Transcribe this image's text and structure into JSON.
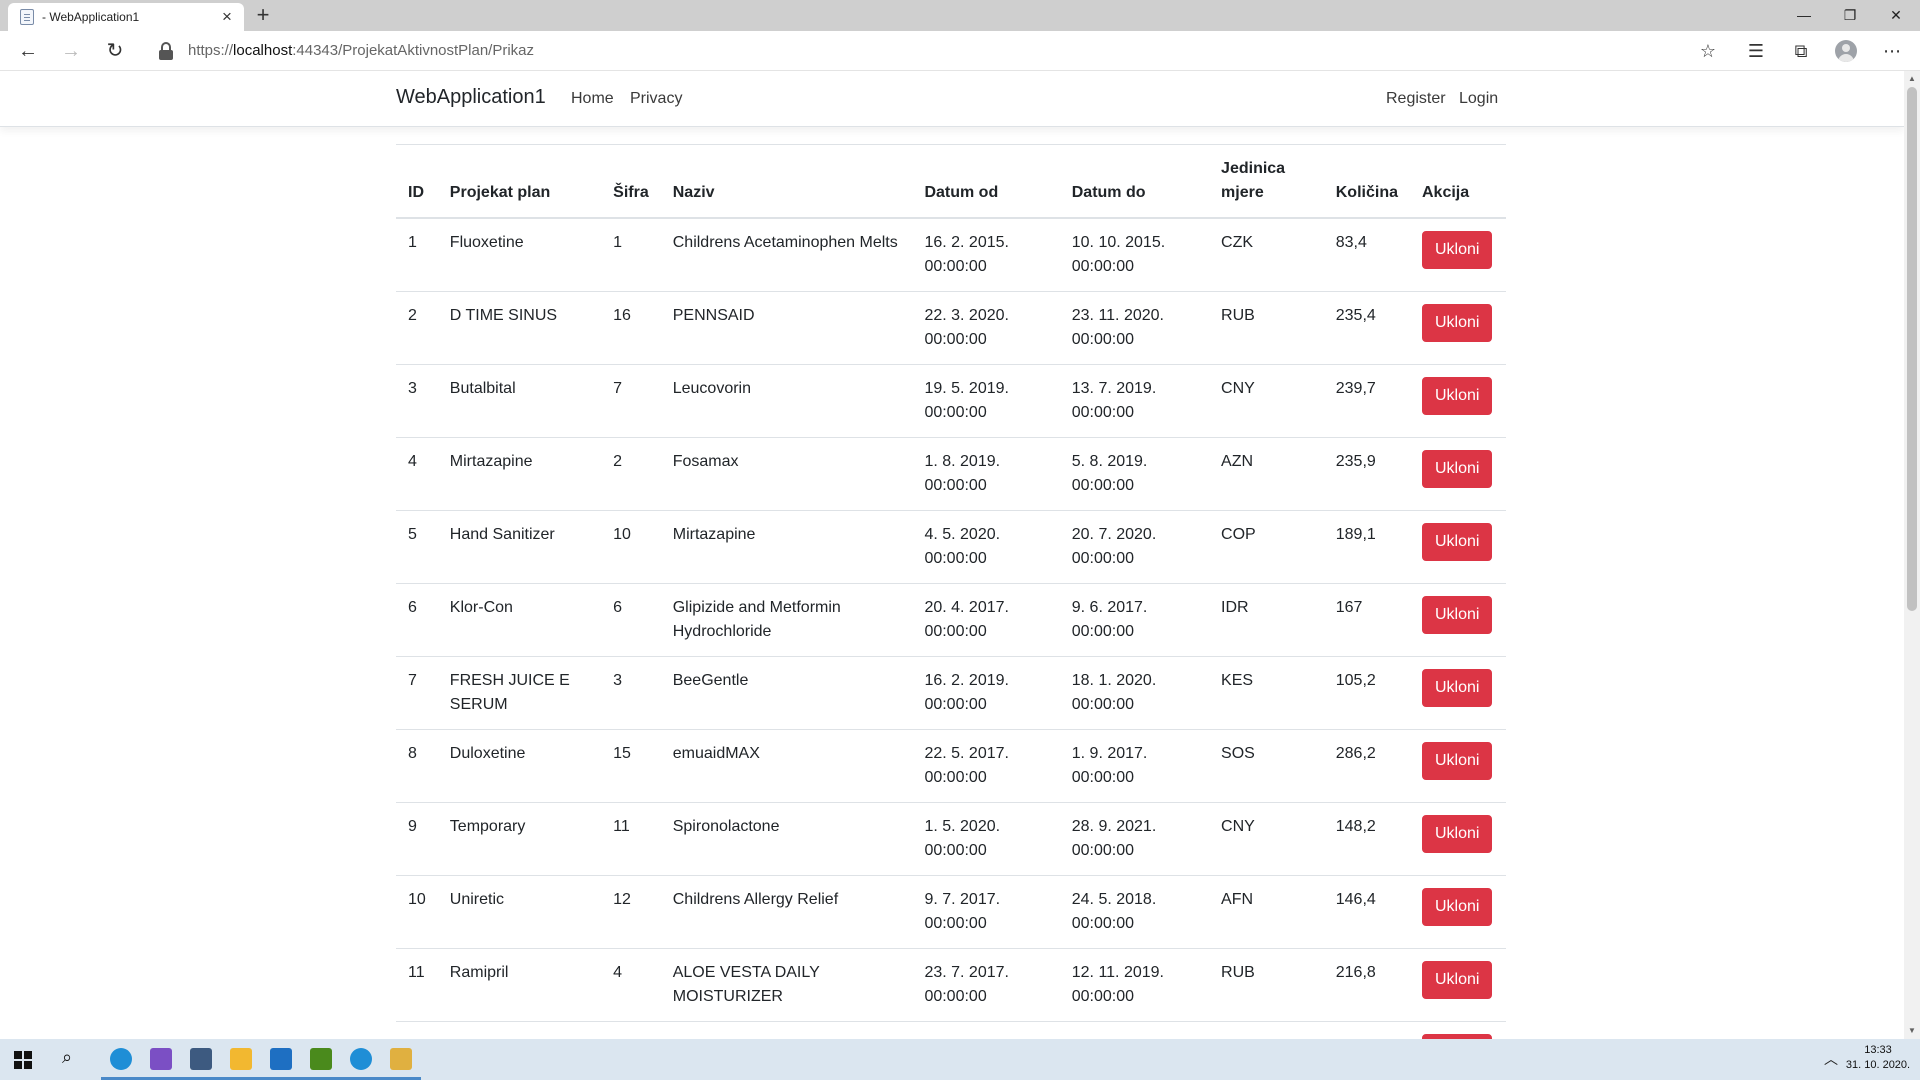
{
  "browser": {
    "tab_title": " - WebApplication1",
    "url_scheme": "https://",
    "url_host": "localhost",
    "url_path": ":44343/ProjekatAktivnostPlan/Prikaz"
  },
  "site": {
    "brand": "WebApplication1",
    "nav": {
      "home": "Home",
      "privacy": "Privacy",
      "register": "Register",
      "login": "Login"
    }
  },
  "table": {
    "headers": {
      "id": "ID",
      "plan": "Projekat plan",
      "sifra": "Šifra",
      "naziv": "Naziv",
      "datum_od": "Datum od",
      "datum_do": "Datum do",
      "jedinica": "Jedinica mjere",
      "kolicina": "Količina",
      "akcija": "Akcija"
    },
    "action_label": "Ukloni",
    "rows": [
      {
        "id": "1",
        "plan": "Fluoxetine",
        "sifra": "1",
        "naziv": "Childrens Acetaminophen Melts",
        "od": "16. 2. 2015. 00:00:00",
        "do": "10. 10. 2015. 00:00:00",
        "jm": "CZK",
        "kol": "83,4"
      },
      {
        "id": "2",
        "plan": "D TIME SINUS",
        "sifra": "16",
        "naziv": "PENNSAID",
        "od": "22. 3. 2020. 00:00:00",
        "do": "23. 11. 2020. 00:00:00",
        "jm": "RUB",
        "kol": "235,4"
      },
      {
        "id": "3",
        "plan": "Butalbital",
        "sifra": "7",
        "naziv": "Leucovorin",
        "od": "19. 5. 2019. 00:00:00",
        "do": "13. 7. 2019. 00:00:00",
        "jm": "CNY",
        "kol": "239,7"
      },
      {
        "id": "4",
        "plan": "Mirtazapine",
        "sifra": "2",
        "naziv": "Fosamax",
        "od": "1. 8. 2019. 00:00:00",
        "do": "5. 8. 2019. 00:00:00",
        "jm": "AZN",
        "kol": "235,9"
      },
      {
        "id": "5",
        "plan": "Hand Sanitizer",
        "sifra": "10",
        "naziv": "Mirtazapine",
        "od": "4. 5. 2020. 00:00:00",
        "do": "20. 7. 2020. 00:00:00",
        "jm": "COP",
        "kol": "189,1"
      },
      {
        "id": "6",
        "plan": "Klor-Con",
        "sifra": "6",
        "naziv": "Glipizide and Metformin Hydrochloride",
        "od": "20. 4. 2017. 00:00:00",
        "do": "9. 6. 2017. 00:00:00",
        "jm": "IDR",
        "kol": "167"
      },
      {
        "id": "7",
        "plan": "FRESH JUICE E SERUM",
        "sifra": "3",
        "naziv": "BeeGentle",
        "od": "16. 2. 2019. 00:00:00",
        "do": "18. 1. 2020. 00:00:00",
        "jm": "KES",
        "kol": "105,2"
      },
      {
        "id": "8",
        "plan": "Duloxetine",
        "sifra": "15",
        "naziv": "emuaidMAX",
        "od": "22. 5. 2017. 00:00:00",
        "do": "1. 9. 2017. 00:00:00",
        "jm": "SOS",
        "kol": "286,2"
      },
      {
        "id": "9",
        "plan": "Temporary",
        "sifra": "11",
        "naziv": "Spironolactone",
        "od": "1. 5. 2020. 00:00:00",
        "do": "28. 9. 2021. 00:00:00",
        "jm": "CNY",
        "kol": "148,2"
      },
      {
        "id": "10",
        "plan": "Uniretic",
        "sifra": "12",
        "naziv": "Childrens Allergy Relief",
        "od": "9. 7. 2017. 00:00:00",
        "do": "24. 5. 2018. 00:00:00",
        "jm": "AFN",
        "kol": "146,4"
      },
      {
        "id": "11",
        "plan": "Ramipril",
        "sifra": "4",
        "naziv": "ALOE VESTA DAILY MOISTURIZER",
        "od": "23. 7. 2017. 00:00:00",
        "do": "12. 11. 2019. 00:00:00",
        "jm": "RUB",
        "kol": "216,8"
      },
      {
        "id": "",
        "plan": "",
        "sifra": "",
        "naziv": "",
        "od": "",
        "do": "",
        "jm": "",
        "kol": ""
      }
    ]
  },
  "taskbar": {
    "time": "13:33",
    "date": "31. 10. 2020.",
    "apps": [
      {
        "icon": "edge-icon",
        "color": "#1f8ed6"
      },
      {
        "icon": "visual-studio-icon",
        "color": "#7b4fc4"
      },
      {
        "icon": "sql-server-management-icon",
        "color": "#3d5a80"
      },
      {
        "icon": "file-explorer-icon",
        "color": "#f2b830"
      },
      {
        "icon": "photos-icon",
        "color": "#1e6fc2"
      },
      {
        "icon": "nvidia-icon",
        "color": "#4a8a1c"
      },
      {
        "icon": "edge-icon",
        "color": "#1f8ed6"
      },
      {
        "icon": "paint-icon",
        "color": "#e0b040"
      }
    ]
  },
  "colors": {
    "danger": "#dc3545",
    "taskbar": "#dbe6f0",
    "tabstrip": "#cfcfcf"
  }
}
